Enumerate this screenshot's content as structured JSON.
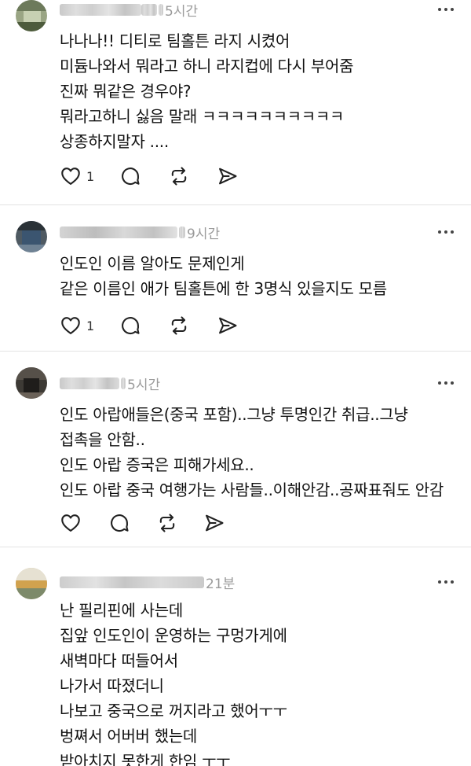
{
  "posts": [
    {
      "time": "5시간",
      "lines": [
        "나나나!! 디티로 팀홀튼 라지 시켰어",
        "미듐나와서 뭐라고 하니 라지컵에 다시 부어줌",
        "진짜 뭐같은 경우야?",
        "뭐라고하니 싫음 말래 ㅋㅋㅋㅋㅋㅋㅋㅋㅋㅋ",
        "상종하지말자 ...."
      ],
      "like_count": "1"
    },
    {
      "time": "9시간",
      "lines": [
        "인도인 이름 알아도 문제인게",
        "같은 이름인 애가 팀홀튼에 한 3명식 있을지도 모름"
      ],
      "like_count": "1"
    },
    {
      "time": "5시간",
      "lines": [
        "인도 아랍애들은(중국 포함)..그냥 투명인간 취급..그냥",
        "접촉을 안함..",
        "인도 아랍 증국은 피해가세요..",
        "인도 아랍 중국 여행가는 사람들..이해안감..공짜표줘도 안감"
      ],
      "like_count": ""
    },
    {
      "time": "21분",
      "lines": [
        "난 필리핀에 사는데",
        "집앞 인도인이 운영하는 구멍가게에",
        "새벽마다 떠들어서",
        "나가서 따졌더니",
        "나보고 중국으로 꺼지라고 했어ㅜㅜ",
        "벙쪄서 어버버 했는데",
        "받아치지 못한게 한임 ㅜㅜ"
      ],
      "like_count": ""
    }
  ],
  "icons": {
    "like": "heart-icon",
    "reply": "comment-bubble-icon",
    "repost": "repost-icon",
    "share": "send-icon",
    "more": "more-dots-icon"
  }
}
